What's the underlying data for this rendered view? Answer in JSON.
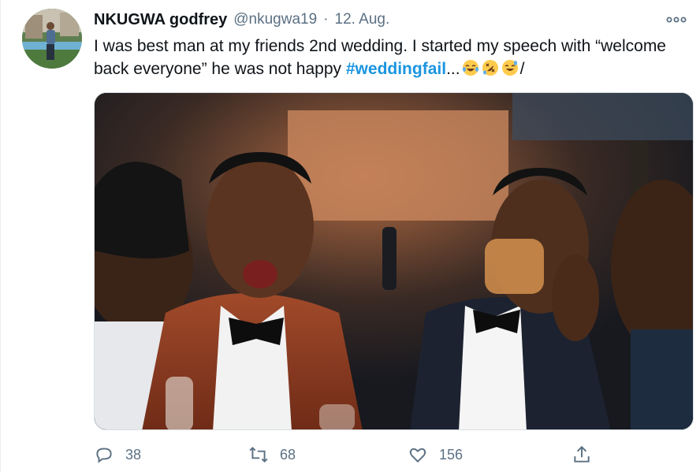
{
  "author": {
    "name": "NKUGWA godfrey",
    "handle": "@nkugwa19",
    "separator": "·",
    "date": "12. Aug."
  },
  "tweet": {
    "text_part1": "I was best man at my friends 2nd wedding. I started my speech with “welcome back everyone” he was not happy ",
    "hashtag": "#weddingfail",
    "ellipsis": "...",
    "text_suffix": "/"
  },
  "actions": {
    "reply": {
      "count": "38",
      "icon": "reply-icon"
    },
    "retweet": {
      "count": "68",
      "icon": "retweet-icon"
    },
    "like": {
      "count": "156",
      "icon": "heart-icon"
    },
    "share": {
      "icon": "share-icon"
    }
  },
  "colors": {
    "hashtag": "#1b95e0",
    "secondary_text": "#5b7083",
    "primary_text": "#0f1419"
  }
}
